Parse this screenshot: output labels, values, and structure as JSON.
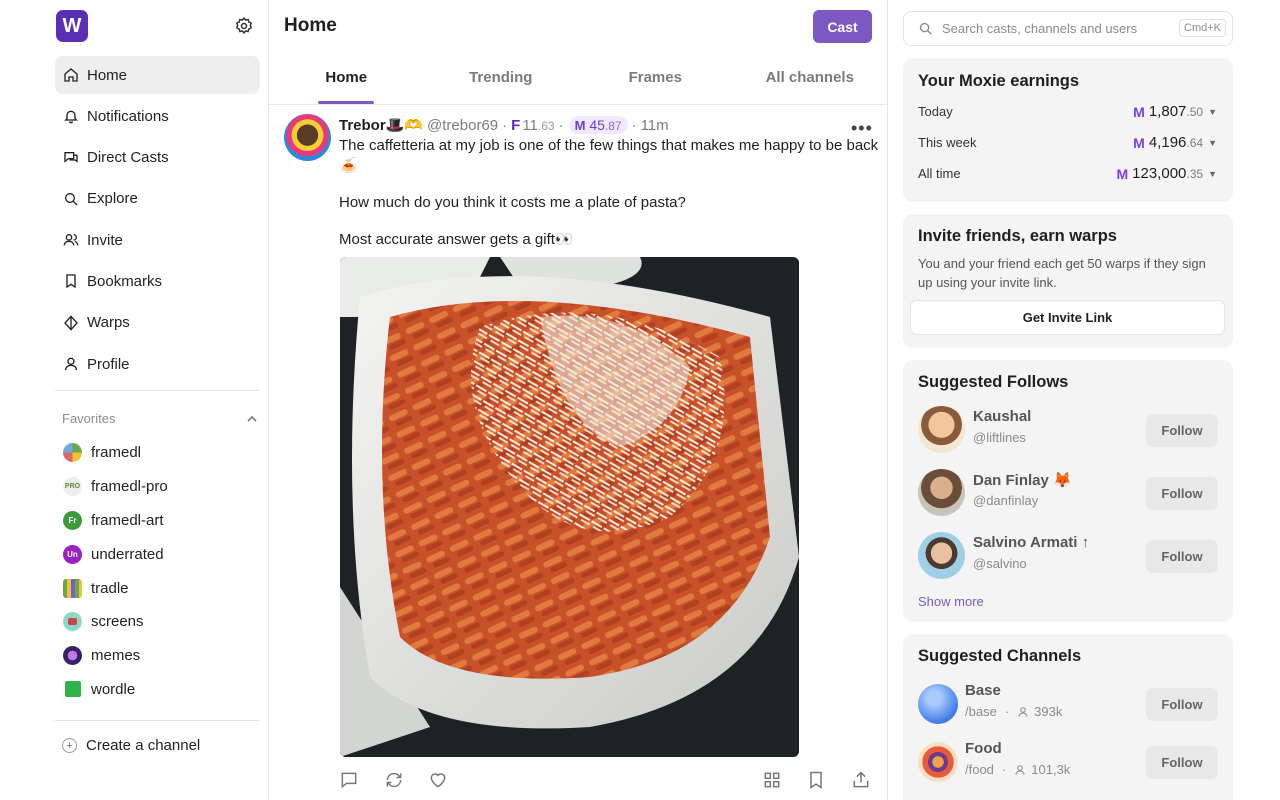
{
  "app": {
    "logo_letter": "W",
    "accent": "#7c58c2"
  },
  "sidebar": {
    "nav": [
      {
        "label": "Home",
        "icon": "home-icon"
      },
      {
        "label": "Notifications",
        "icon": "bell-icon"
      },
      {
        "label": "Direct Casts",
        "icon": "chat-icon"
      },
      {
        "label": "Explore",
        "icon": "search-icon"
      },
      {
        "label": "Invite",
        "icon": "users-icon"
      },
      {
        "label": "Bookmarks",
        "icon": "bookmark-icon"
      },
      {
        "label": "Warps",
        "icon": "diamond-icon"
      },
      {
        "label": "Profile",
        "icon": "user-icon"
      }
    ],
    "favorites_label": "Favorites",
    "favorites": [
      {
        "label": "framedl",
        "badge": ""
      },
      {
        "label": "framedl-pro",
        "badge": "PRO"
      },
      {
        "label": "framedl-art",
        "badge": "Fr"
      },
      {
        "label": "underrated",
        "badge": "Un"
      },
      {
        "label": "tradle",
        "badge": ""
      },
      {
        "label": "screens",
        "badge": ""
      },
      {
        "label": "memes",
        "badge": ""
      },
      {
        "label": "wordle",
        "badge": ""
      }
    ],
    "create_label": "Create a channel"
  },
  "main": {
    "title": "Home",
    "cast_button": "Cast",
    "tabs": [
      "Home",
      "Trending",
      "Frames",
      "All channels"
    ],
    "post": {
      "author": "Trebor🎩🫶",
      "handle": "@trebor69",
      "fcast_score": "11",
      "fcast_decimals": ".63",
      "moxie": "45",
      "moxie_decimals": ".87",
      "time": "11m",
      "text": [
        "The caffetteria at my job is one of the few things that makes me happy to be back 🍝",
        "How much do you think it costs me a plate of pasta?",
        "Most accurate answer gets a gift👀"
      ]
    }
  },
  "right": {
    "search_placeholder": "Search casts, channels and users",
    "shortcut": "Cmd+K",
    "earnings": {
      "title": "Your Moxie earnings",
      "rows": [
        {
          "label": "Today",
          "whole": "1,807",
          "dec": ".50"
        },
        {
          "label": "This week",
          "whole": "4,196",
          "dec": ".64"
        },
        {
          "label": "All time",
          "whole": "123,000",
          "dec": ".35"
        }
      ]
    },
    "invite": {
      "title": "Invite friends, earn warps",
      "text": "You and your friend each get 50 warps if they sign up using your invite link.",
      "button": "Get Invite Link"
    },
    "suggested_follows": {
      "title": "Suggested Follows",
      "users": [
        {
          "name": "Kaushal",
          "handle": "@liftlines"
        },
        {
          "name": "Dan Finlay 🦊",
          "handle": "@danfinlay"
        },
        {
          "name": "Salvino Armati ↑",
          "handle": "@salvino"
        }
      ],
      "follow_label": "Follow",
      "show_more": "Show more"
    },
    "suggested_channels": {
      "title": "Suggested Channels",
      "channels": [
        {
          "name": "Base",
          "slug": "/base",
          "members": "393k"
        },
        {
          "name": "Food",
          "slug": "/food",
          "members": "101,3k"
        }
      ],
      "follow_label": "Follow"
    }
  }
}
